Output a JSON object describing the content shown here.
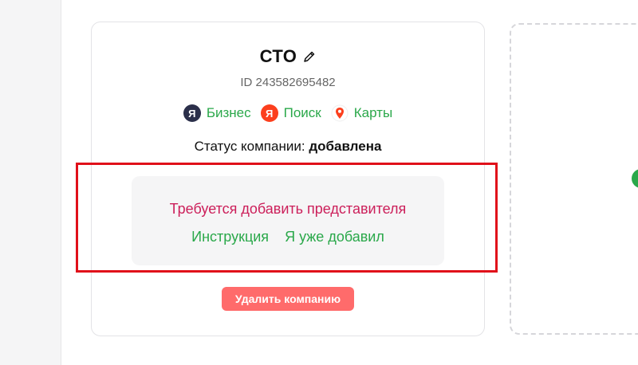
{
  "company": {
    "title": "СТО",
    "id_text": "ID 243582695482",
    "status_label": "Статус компании: ",
    "status_value": "добавлена"
  },
  "services": [
    {
      "label": "Бизнес",
      "icon": "yandex-business-icon",
      "glyph": "Я",
      "color": "#2b2f4a"
    },
    {
      "label": "Поиск",
      "icon": "yandex-search-icon",
      "glyph": "Я",
      "color": "#fc3f1d"
    },
    {
      "label": "Карты",
      "icon": "yandex-maps-pin-icon",
      "color": "#fc3f1d"
    }
  ],
  "representative": {
    "message": "Требуется добавить представителя",
    "instruction_link": "Инструкция",
    "already_added_link": "Я уже добавил"
  },
  "actions": {
    "delete_label": "Удалить компанию"
  },
  "colors": {
    "accent_green": "#2aa84a",
    "warning_text": "#cc1f5a",
    "delete_button": "#ff6b6b",
    "highlight_border": "#e0101a"
  }
}
